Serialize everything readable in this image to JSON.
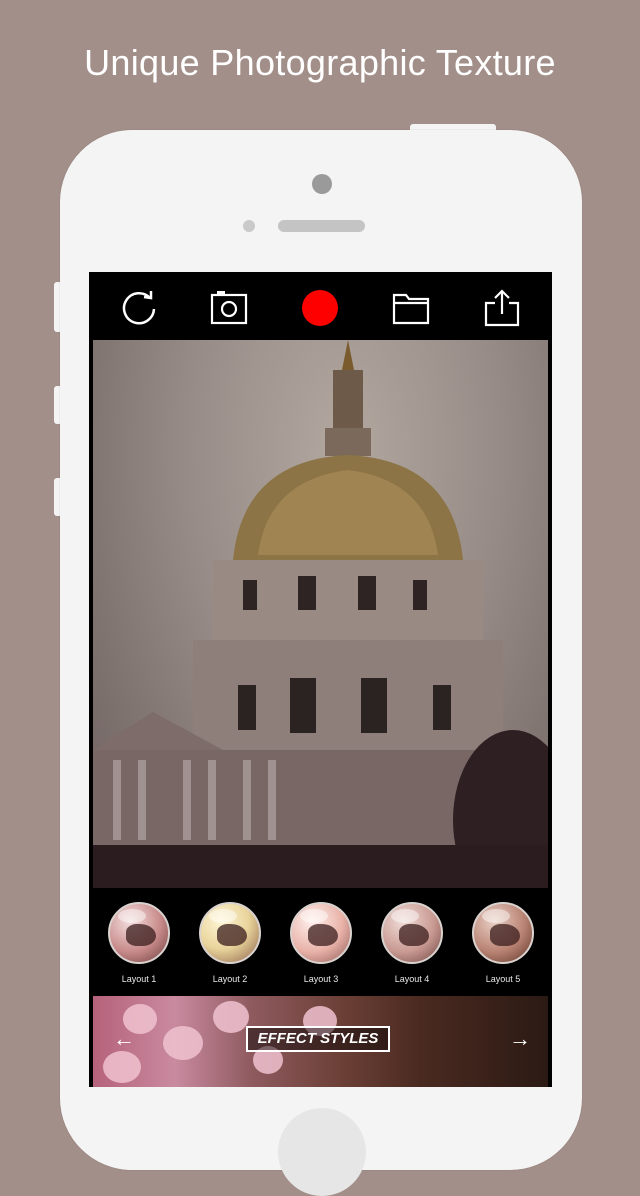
{
  "headline": "Unique Photographic Texture",
  "toolbar": {
    "icons": [
      "refresh-icon",
      "camera-icon",
      "record-button",
      "folder-icon",
      "share-icon"
    ],
    "record_color": "#ff0000"
  },
  "layouts": [
    {
      "label": "Layout 1",
      "tint": "#c88a8a"
    },
    {
      "label": "Layout 2",
      "tint": "#e8d39a"
    },
    {
      "label": "Layout 3",
      "tint": "#e8b2a8"
    },
    {
      "label": "Layout 4",
      "tint": "#c99a92"
    },
    {
      "label": "Layout 5",
      "tint": "#b88272"
    }
  ],
  "effects": {
    "label": "EFFECT STYLES",
    "prev_icon": "←",
    "next_icon": "→"
  },
  "colors": {
    "background": "#a38f89",
    "phone": "#f4f4f4",
    "screen": "#000000"
  }
}
